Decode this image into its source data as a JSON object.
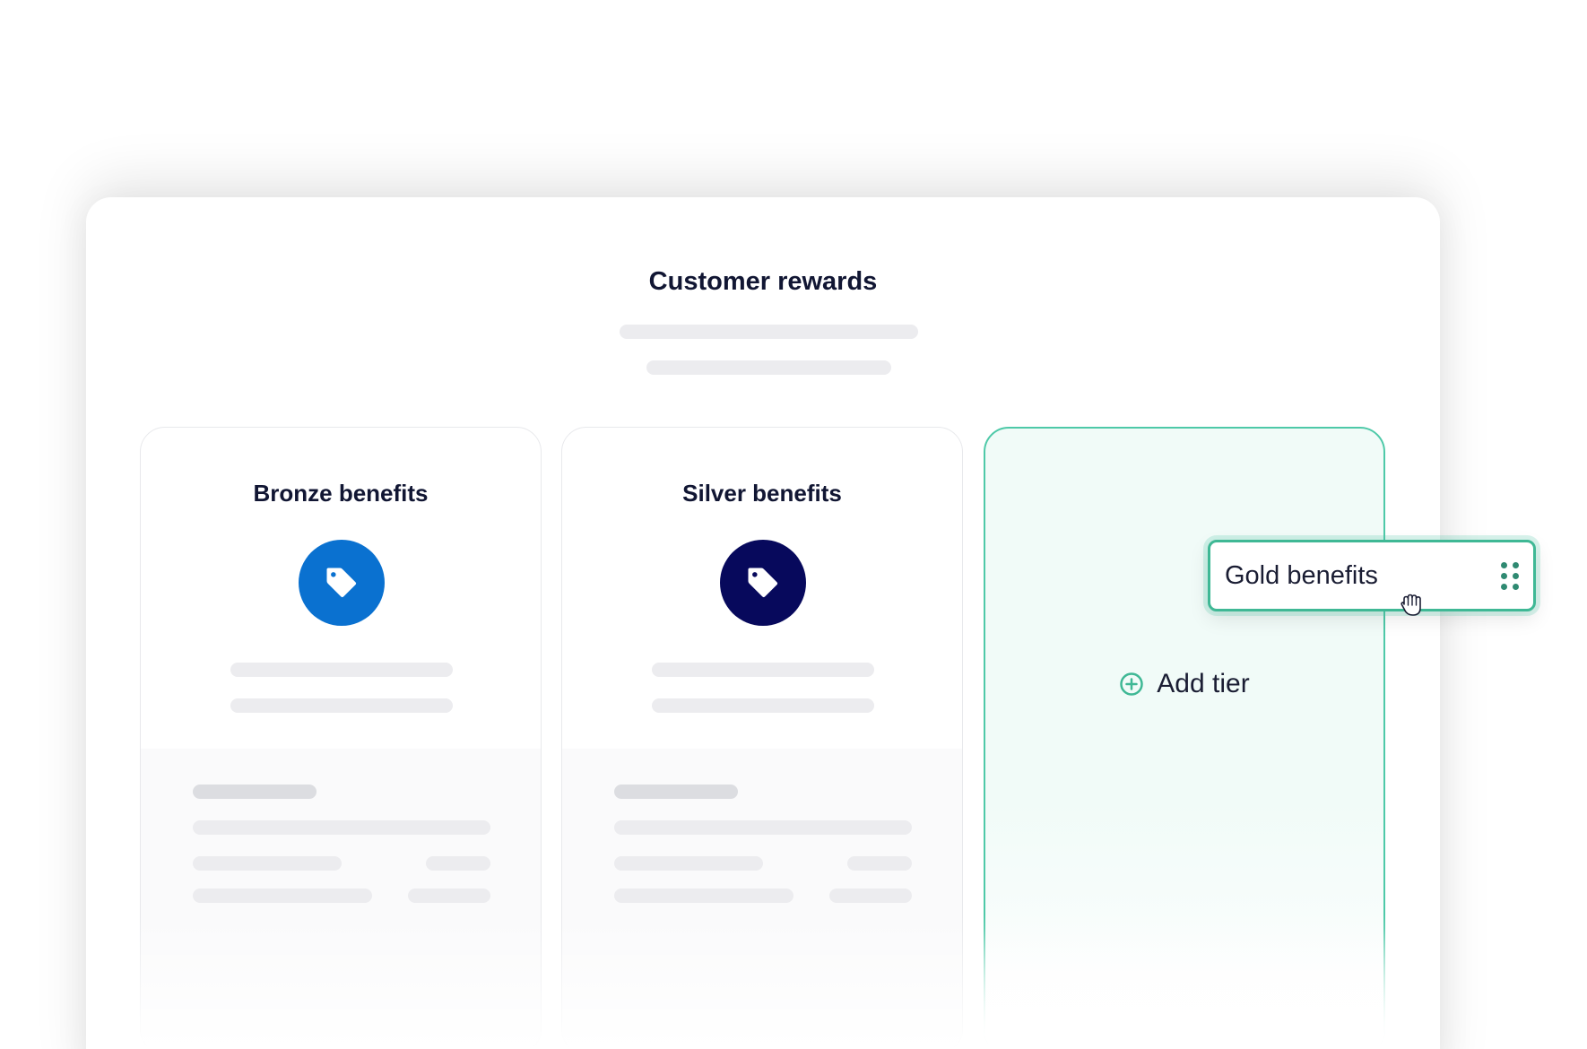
{
  "page": {
    "title": "Customer rewards"
  },
  "cards": [
    {
      "title": "Bronze benefits",
      "icon": "tag-icon",
      "icon_color": "#0a71d0"
    },
    {
      "title": "Silver benefits",
      "icon": "tag-icon",
      "icon_color": "#07095c"
    }
  ],
  "tier_card": {
    "add_label": "Add tier",
    "accent": "#4ec9a8"
  },
  "drag_chip": {
    "label": "Gold benefits"
  }
}
